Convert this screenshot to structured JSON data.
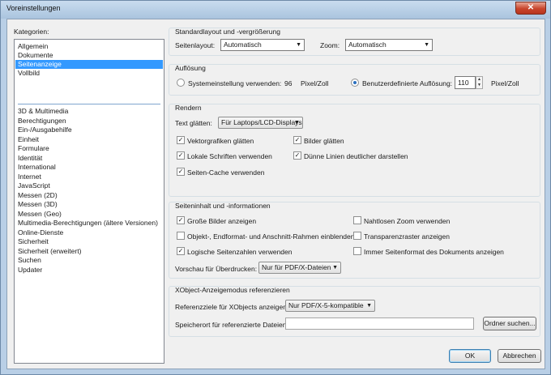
{
  "window": {
    "title": "Voreinstellungen",
    "close_glyph": "✕"
  },
  "categories": {
    "label": "Kategorien:",
    "top_items": [
      "Allgemein",
      "Dokumente",
      "Seitenanzeige",
      "Vollbild"
    ],
    "selected": "Seitenanzeige",
    "items": [
      "3D & Multimedia",
      "Berechtigungen",
      "Ein-/Ausgabehilfe",
      "Einheit",
      "Formulare",
      "Identität",
      "International",
      "Internet",
      "JavaScript",
      "Messen (2D)",
      "Messen (3D)",
      "Messen (Geo)",
      "Multimedia-Berechtigungen (ältere Versionen)",
      "Online-Dienste",
      "Sicherheit",
      "Sicherheit (erweitert)",
      "Suchen",
      "Updater"
    ]
  },
  "layout": {
    "title": "Standardlayout und -vergrößerung",
    "seitenlayout_label": "Seitenlayout:",
    "seitenlayout_value": "Automatisch",
    "zoom_label": "Zoom:",
    "zoom_value": "Automatisch"
  },
  "resolution": {
    "title": "Auflösung",
    "system_label": "Systemeinstellung verwenden:",
    "system_value": "96",
    "system_unit": "Pixel/Zoll",
    "custom_label": "Benutzerdefinierte Auflösung:",
    "custom_value": "110",
    "custom_unit": "Pixel/Zoll",
    "selected": "custom"
  },
  "rendering": {
    "title": "Rendern",
    "text_label": "Text glätten:",
    "text_value": "Für Laptops/LCD-Displays",
    "checkboxes": [
      {
        "label": "Vektorgrafiken glätten",
        "checked": true
      },
      {
        "label": "Bilder glätten",
        "checked": true
      },
      {
        "label": "Lokale Schriften verwenden",
        "checked": true
      },
      {
        "label": "Dünne Linien deutlicher darstellen",
        "checked": true
      },
      {
        "label": "Seiten-Cache verwenden",
        "checked": true
      }
    ]
  },
  "content": {
    "title": "Seiteninhalt und -informationen",
    "checkboxes": [
      {
        "label": "Große Bilder anzeigen",
        "checked": true
      },
      {
        "label": "Nahtlosen Zoom verwenden",
        "checked": false
      },
      {
        "label": "Objekt-, Endformat- und Anschnitt-Rahmen einblenden",
        "checked": false
      },
      {
        "label": "Transparenzraster anzeigen",
        "checked": false
      },
      {
        "label": "Logische Seitenzahlen verwenden",
        "checked": true
      },
      {
        "label": "Immer Seitenformat des Dokuments anzeigen",
        "checked": false
      }
    ],
    "overprint_label": "Vorschau für Überdrucken:",
    "overprint_value": "Nur für PDF/X-Dateien"
  },
  "xobject": {
    "title": "XObject-Anzeigemodus referenzieren",
    "targets_label": "Referenzziele für XObjects anzeigen:",
    "targets_value": "Nur PDF/X-5-kompatible",
    "location_label": "Speicherort für referenzierte Dateien:",
    "location_value": "",
    "browse_button": "Ordner suchen..."
  },
  "footer": {
    "ok": "OK",
    "cancel": "Abbrechen"
  },
  "icons": {
    "dropdown": "dropdown-arrow-icon",
    "check": "checkmark-icon",
    "spin": "spin-arrows-icon"
  }
}
